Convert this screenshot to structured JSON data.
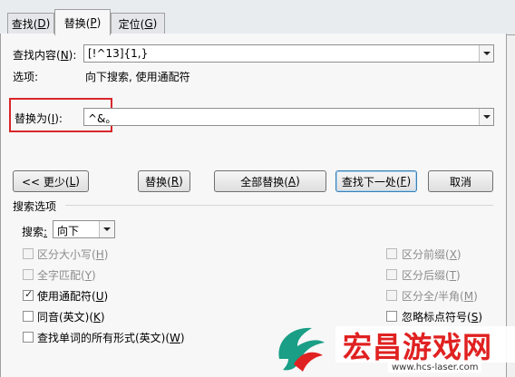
{
  "tabs": [
    {
      "label": "查找(",
      "key": "D",
      "suffix": ")"
    },
    {
      "label": "替换(",
      "key": "P",
      "suffix": ")"
    },
    {
      "label": "定位(",
      "key": "G",
      "suffix": ")"
    }
  ],
  "find": {
    "label": "查找内容(",
    "key": "N",
    "suffix": "):",
    "value": "[!^13]{1,}"
  },
  "options": {
    "label": "选项:",
    "value": "向下搜索, 使用通配符"
  },
  "replace": {
    "label": "替换为(",
    "key": "I",
    "suffix": "):",
    "value": "^&。"
  },
  "buttons": {
    "less": {
      "label": "<< 更少(",
      "key": "L",
      "suffix": ")"
    },
    "replace": {
      "label": "替换(",
      "key": "R",
      "suffix": ")"
    },
    "replace_all": {
      "label": "全部替换(",
      "key": "A",
      "suffix": ")"
    },
    "find_next": {
      "label": "查找下一处(",
      "key": "F",
      "suffix": ")"
    },
    "cancel": {
      "label": "取消"
    }
  },
  "search_options": {
    "title": "搜索选项",
    "search_label": "搜索",
    "search_key": ":",
    "search_value": "向下"
  },
  "checkboxes_left": [
    {
      "label": "区分大小写(",
      "key": "H",
      "suffix": ")",
      "checked": false,
      "enabled": false
    },
    {
      "label": "全字匹配(",
      "key": "Y",
      "suffix": ")",
      "checked": false,
      "enabled": false
    },
    {
      "label": "使用通配符(",
      "key": "U",
      "suffix": ")",
      "checked": true,
      "enabled": true
    },
    {
      "label": "同音(英文)(",
      "key": "K",
      "suffix": ")",
      "checked": false,
      "enabled": true
    },
    {
      "label": "查找单词的所有形式(英文)(",
      "key": "W",
      "suffix": ")",
      "checked": false,
      "enabled": true
    }
  ],
  "checkboxes_right": [
    {
      "label": "区分前缀(",
      "key": "X",
      "suffix": ")",
      "checked": false,
      "enabled": false
    },
    {
      "label": "区分后缀(",
      "key": "T",
      "suffix": ")",
      "checked": false,
      "enabled": false
    },
    {
      "label": "区分全/半角(",
      "key": "M",
      "suffix": ")",
      "checked": false,
      "enabled": false
    },
    {
      "label": "忽略标点符号(",
      "key": "S",
      "suffix": ")",
      "checked": false,
      "enabled": true
    }
  ],
  "watermark": {
    "title": "宏昌游戏网",
    "url": "www.hcs-laser.com"
  },
  "colors": {
    "highlight_box": "#d9262c",
    "watermark_teal": "#1a9e86",
    "watermark_red": "#e02121"
  }
}
